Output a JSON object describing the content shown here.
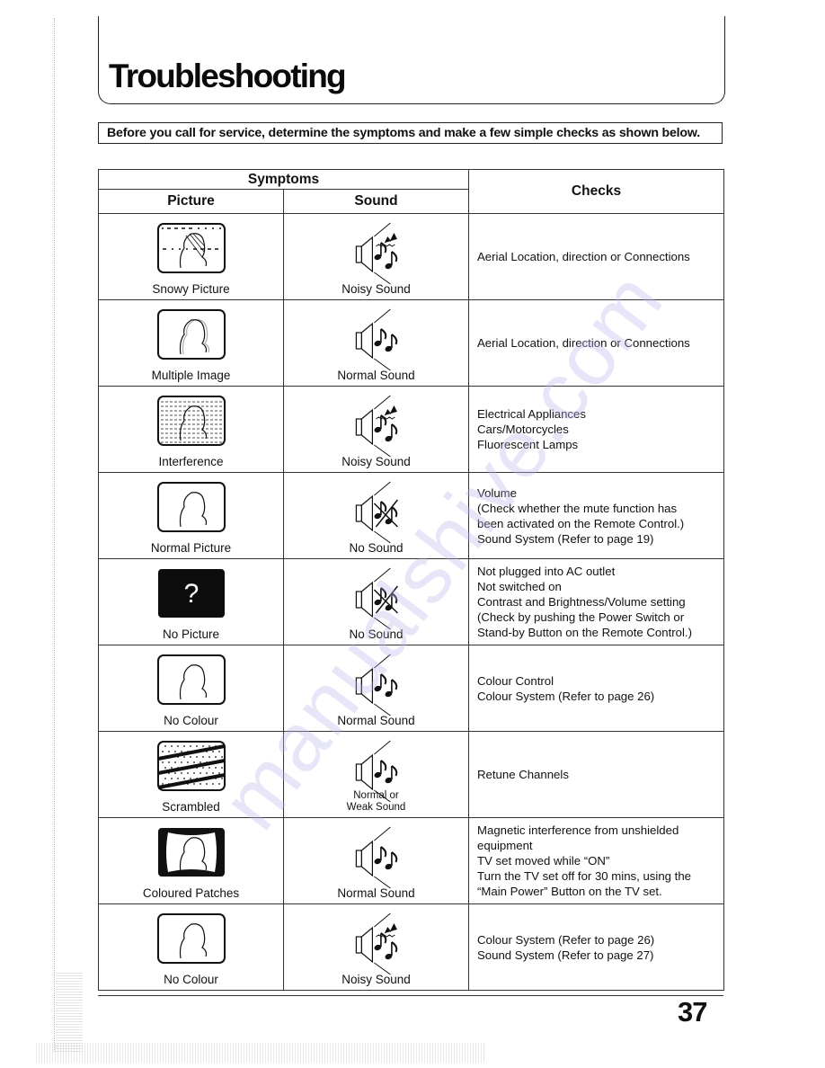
{
  "page": {
    "title": "Troubleshooting",
    "intro": "Before you call for service, determine the symptoms and make a few simple checks as shown below.",
    "page_number": "37",
    "watermark": "manualshive.com"
  },
  "table": {
    "header": {
      "symptoms": "Symptoms",
      "picture": "Picture",
      "sound": "Sound",
      "checks": "Checks"
    },
    "rows": [
      {
        "picture": {
          "label": "Snowy Picture",
          "icon": "tv-snowy-picture-icon"
        },
        "sound": {
          "label": "Noisy Sound",
          "icon": "speaker-noisy-sound-icon"
        },
        "checks": [
          "Aerial Location, direction or Connections"
        ]
      },
      {
        "picture": {
          "label": "Multiple Image",
          "icon": "tv-multiple-image-icon"
        },
        "sound": {
          "label": "Normal Sound",
          "icon": "speaker-normal-sound-icon"
        },
        "checks": [
          "Aerial Location, direction or Connections"
        ]
      },
      {
        "picture": {
          "label": "Interference",
          "icon": "tv-interference-icon"
        },
        "sound": {
          "label": "Noisy Sound",
          "icon": "speaker-noisy-sound-icon"
        },
        "checks": [
          "Electrical Appliances",
          "Cars/Motorcycles",
          "Fluorescent Lamps"
        ]
      },
      {
        "picture": {
          "label": "Normal Picture",
          "icon": "tv-normal-picture-icon"
        },
        "sound": {
          "label": "No Sound",
          "icon": "speaker-no-sound-icon"
        },
        "checks": [
          "Volume",
          "(Check whether the mute function has",
          "been activated on the Remote Control.)",
          "Sound System (Refer to page 19)"
        ]
      },
      {
        "picture": {
          "label": "No Picture",
          "icon": "tv-no-picture-icon",
          "glyph": "?"
        },
        "sound": {
          "label": "No Sound",
          "icon": "speaker-no-sound-icon"
        },
        "checks": [
          "Not plugged into AC outlet",
          "Not switched on",
          "Contrast and Brightness/Volume setting",
          "(Check by pushing the Power Switch or",
          "Stand-by Button on the Remote Control.)"
        ]
      },
      {
        "picture": {
          "label": "No Colour",
          "icon": "tv-no-colour-icon"
        },
        "sound": {
          "label": "Normal Sound",
          "icon": "speaker-normal-sound-icon"
        },
        "checks": [
          "Colour Control",
          "Colour System (Refer to page 26)"
        ]
      },
      {
        "picture": {
          "label": "Scrambled",
          "icon": "tv-scrambled-icon"
        },
        "sound": {
          "label_line1": "Normal or",
          "label_line2": "Weak Sound",
          "icon": "speaker-normal-or-weak-sound-icon"
        },
        "checks": [
          "Retune Channels"
        ]
      },
      {
        "picture": {
          "label": "Coloured Patches",
          "icon": "tv-coloured-patches-icon"
        },
        "sound": {
          "label": "Normal Sound",
          "icon": "speaker-normal-sound-icon"
        },
        "checks": [
          "Magnetic interference from unshielded",
          "equipment",
          "TV set moved while “ON”",
          "Turn the TV set off for 30 mins, using the",
          "“Main Power” Button on the TV set."
        ]
      },
      {
        "picture": {
          "label": "No Colour",
          "icon": "tv-no-colour-icon"
        },
        "sound": {
          "label": "Noisy Sound",
          "icon": "speaker-noisy-sound-icon"
        },
        "checks": [
          "Colour System (Refer to page 26)",
          "Sound System (Refer to page 27)"
        ]
      }
    ]
  }
}
